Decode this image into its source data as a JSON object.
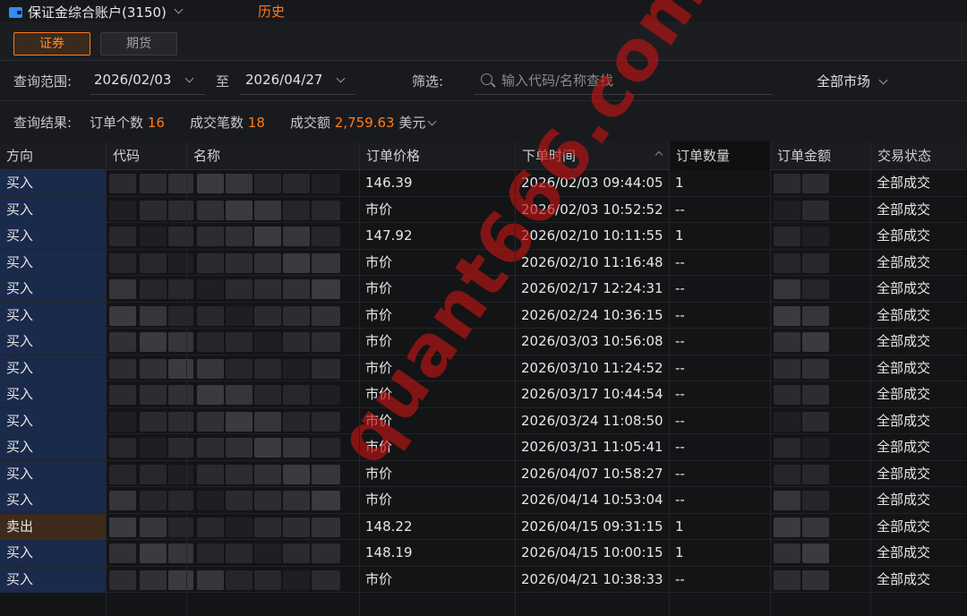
{
  "topbar": {
    "account_label": "保证金综合账户(3150)",
    "history_tab": "历史"
  },
  "segments": {
    "securities": "证券",
    "futures": "期货"
  },
  "filter": {
    "range_label": "查询范围:",
    "start_date": "2026/02/03",
    "to_label": "至",
    "end_date": "2026/04/27",
    "filter_label": "筛选:",
    "search_placeholder": "输入代码/名称查找",
    "market": "全部市场"
  },
  "summary": {
    "result_label": "查询结果:",
    "order_count_label": "订单个数",
    "order_count": "16",
    "trade_count_label": "成交笔数",
    "trade_count": "18",
    "amount_label": "成交额",
    "amount": "2,759.63",
    "currency": "美元"
  },
  "table": {
    "columns": [
      "方向",
      "代码",
      "名称",
      "订单价格",
      "下单时间",
      "订单数量",
      "订单金额",
      "交易状态"
    ],
    "rows": [
      {
        "direction": "买入",
        "price": "146.39",
        "time": "2026/02/03 09:44:05",
        "qty": "1",
        "status": "全部成交"
      },
      {
        "direction": "买入",
        "price": "市价",
        "time": "2026/02/03 10:52:52",
        "qty": "--",
        "status": "全部成交"
      },
      {
        "direction": "买入",
        "price": "147.92",
        "time": "2026/02/10 10:11:55",
        "qty": "1",
        "status": "全部成交"
      },
      {
        "direction": "买入",
        "price": "市价",
        "time": "2026/02/10 11:16:48",
        "qty": "--",
        "status": "全部成交"
      },
      {
        "direction": "买入",
        "price": "市价",
        "time": "2026/02/17 12:24:31",
        "qty": "--",
        "status": "全部成交"
      },
      {
        "direction": "买入",
        "price": "市价",
        "time": "2026/02/24 10:36:15",
        "qty": "--",
        "status": "全部成交"
      },
      {
        "direction": "买入",
        "price": "市价",
        "time": "2026/03/03 10:56:08",
        "qty": "--",
        "status": "全部成交"
      },
      {
        "direction": "买入",
        "price": "市价",
        "time": "2026/03/10 11:24:52",
        "qty": "--",
        "status": "全部成交"
      },
      {
        "direction": "买入",
        "price": "市价",
        "time": "2026/03/17 10:44:54",
        "qty": "--",
        "status": "全部成交"
      },
      {
        "direction": "买入",
        "price": "市价",
        "time": "2026/03/24 11:08:50",
        "qty": "--",
        "status": "全部成交"
      },
      {
        "direction": "买入",
        "price": "市价",
        "time": "2026/03/31 11:05:41",
        "qty": "--",
        "status": "全部成交"
      },
      {
        "direction": "买入",
        "price": "市价",
        "time": "2026/04/07 10:58:27",
        "qty": "--",
        "status": "全部成交"
      },
      {
        "direction": "买入",
        "price": "市价",
        "time": "2026/04/14 10:53:04",
        "qty": "--",
        "status": "全部成交"
      },
      {
        "direction": "卖出",
        "price": "148.22",
        "time": "2026/04/15 09:31:15",
        "qty": "1",
        "status": "全部成交"
      },
      {
        "direction": "买入",
        "price": "148.19",
        "time": "2026/04/15 10:00:15",
        "qty": "1",
        "status": "全部成交"
      },
      {
        "direction": "买入",
        "price": "市价",
        "time": "2026/04/21 10:38:33",
        "qty": "--",
        "status": "全部成交"
      }
    ]
  },
  "watermark": "quant666.com",
  "colors": {
    "accent": "#ff7a1a",
    "buy_bg": "#1a2a4a",
    "sell_bg": "#3e2a1a"
  },
  "icons": [
    "wallet-icon",
    "chevron-down-icon",
    "search-icon",
    "sort-asc-icon"
  ]
}
